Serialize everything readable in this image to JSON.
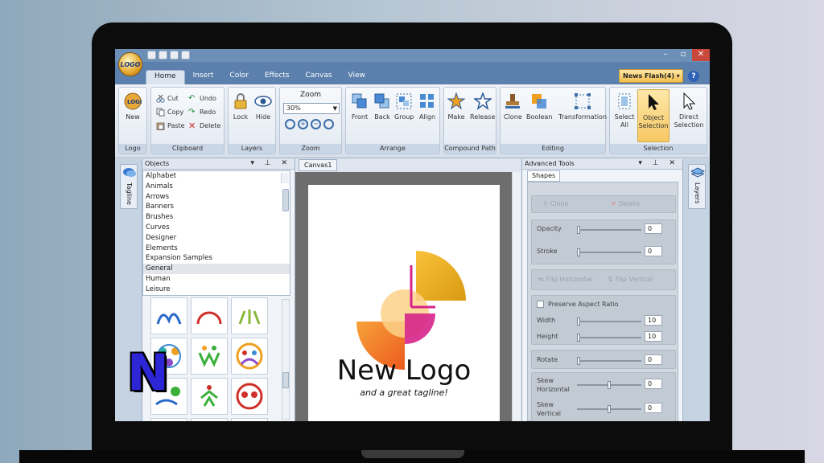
{
  "app": {
    "orb_label": "LOGO",
    "tabs": [
      "Home",
      "Insert",
      "Color",
      "Effects",
      "Canvas",
      "View"
    ],
    "news_flash": "News Flash(4)",
    "help": "?",
    "window_buttons": [
      "–",
      "▫",
      "✕"
    ]
  },
  "ribbon": {
    "logo_group": {
      "new": "New",
      "label": "Logo"
    },
    "clipboard": {
      "cut": "Cut",
      "copy": "Copy",
      "paste": "Paste",
      "undo": "Undo",
      "redo": "Redo",
      "delete": "Delete",
      "label": "Clipboard"
    },
    "layers": {
      "lock": "Lock",
      "hide": "Hide",
      "label": "Layers"
    },
    "zoom": {
      "title": "Zoom",
      "value": "30%",
      "label": "Zoom"
    },
    "arrange": {
      "front": "Front",
      "back": "Back",
      "group": "Group",
      "align": "Align",
      "label": "Arrange"
    },
    "compound": {
      "make": "Make",
      "release": "Release",
      "label": "Compound Path"
    },
    "editing": {
      "clone": "Clone",
      "boolean": "Boolean",
      "transformation": "Transformation",
      "label": "Editing"
    },
    "selection": {
      "select_all": "Select All",
      "object_selection": "Object Selection",
      "direct_selection": "Direct Selection",
      "label": "Selection"
    }
  },
  "left_strip": {
    "tagline_tab": "Tagline"
  },
  "objects_panel": {
    "title": "Objects",
    "items": [
      "Alphabet",
      "Animals",
      "Arrows",
      "Banners",
      "Brushes",
      "Curves",
      "Designer",
      "Elements",
      "Expansion Samples",
      "General",
      "Human",
      "Leisure"
    ],
    "selected_index": 9
  },
  "canvas": {
    "tab": "Canvas1",
    "logo_title": "New Logo",
    "logo_tagline": "and a great tagline!"
  },
  "advanced_tools": {
    "title": "Advanced Tools",
    "tab": "Shapes",
    "clone": "Clone",
    "delete": "Delete",
    "opacity": {
      "label": "Opacity",
      "value": "0"
    },
    "stroke": {
      "label": "Stroke",
      "value": "0"
    },
    "flip_h": "Flip Horizontal",
    "flip_v": "Flip Vertical",
    "preserve": "Preserve Aspect Ratio",
    "width": {
      "label": "Width",
      "value": "10"
    },
    "height": {
      "label": "Height",
      "value": "10"
    },
    "rotate": {
      "label": "Rotate",
      "value": "0"
    },
    "skew_h": {
      "label": "Skew Horizontal",
      "value": "0"
    },
    "skew_v": {
      "label": "Skew Vertical",
      "value": "0"
    }
  },
  "right_strip": {
    "layers_tab": "Layers"
  },
  "overlay_badge": "N"
}
